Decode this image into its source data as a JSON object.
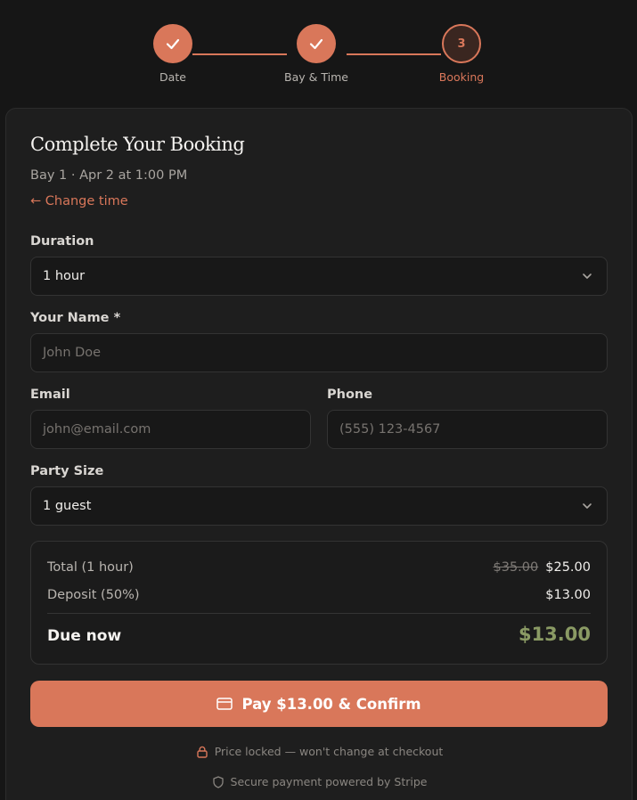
{
  "stepper": {
    "steps": [
      {
        "label": "Date",
        "state": "done"
      },
      {
        "label": "Bay & Time",
        "state": "done"
      },
      {
        "label": "Booking",
        "state": "current",
        "number": "3"
      }
    ]
  },
  "booking": {
    "title": "Complete Your Booking",
    "subtitle": "Bay 1 · Apr 2 at 1:00 PM",
    "change_link": "← Change time"
  },
  "form": {
    "duration": {
      "label": "Duration",
      "value": "1 hour"
    },
    "name": {
      "label": "Your Name *",
      "placeholder": "John Doe"
    },
    "email": {
      "label": "Email",
      "placeholder": "john@email.com"
    },
    "phone": {
      "label": "Phone",
      "placeholder": "(555) 123-4567"
    },
    "party_size": {
      "label": "Party Size",
      "value": "1 guest"
    }
  },
  "summary": {
    "total_label": "Total (1 hour)",
    "total_original": "$35.00",
    "total_price": "$25.00",
    "deposit_label": "Deposit (50%)",
    "deposit_value": "$13.00",
    "due_label": "Due now",
    "due_value": "$13.00"
  },
  "pay_button": {
    "label": "Pay $13.00 & Confirm"
  },
  "notes": {
    "price_locked": "Price locked — won't change at checkout",
    "secure": "Secure payment powered by Stripe"
  },
  "colors": {
    "accent": "#d9775a",
    "due_green": "#8a9a64",
    "background": "#161616",
    "card": "#1e1e1e"
  },
  "icons": {
    "check": "check-icon",
    "chevron": "chevron-down-icon",
    "card": "credit-card-icon",
    "lock": "lock-icon",
    "shield": "shield-icon"
  }
}
